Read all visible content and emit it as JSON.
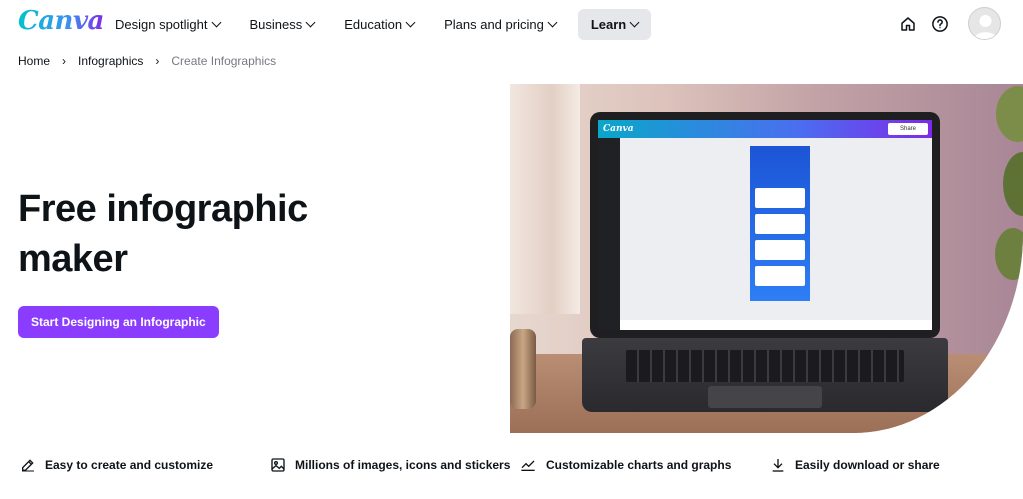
{
  "brand": {
    "logo_text": "Canva",
    "accent": "#8b3dff",
    "logo_gradient": [
      "#00c4cc",
      "#7d2ae8"
    ]
  },
  "nav": {
    "items": [
      {
        "label": "Design spotlight",
        "icon": "chevron-down-icon"
      },
      {
        "label": "Business",
        "icon": "chevron-down-icon"
      },
      {
        "label": "Education",
        "icon": "chevron-down-icon"
      },
      {
        "label": "Plans and pricing",
        "icon": "chevron-down-icon"
      },
      {
        "label": "Learn",
        "icon": "chevron-down-icon",
        "active": true
      }
    ],
    "right_icons": [
      "home-icon",
      "help-icon",
      "avatar"
    ]
  },
  "breadcrumb": {
    "home": "Home",
    "section": "Infographics",
    "current": "Create Infographics"
  },
  "hero": {
    "title_line1": "Free infographic",
    "title_line2": "maker",
    "cta_label": "Start Designing an Infographic"
  },
  "mockup": {
    "app_logo": "Canva",
    "share_label": "Share"
  },
  "features": [
    {
      "label": "Easy to create and customize",
      "icon": "edit-icon"
    },
    {
      "label": "Millions of images, icons and stickers",
      "icon": "image-icon"
    },
    {
      "label": "Customizable charts and graphs",
      "icon": "chart-icon"
    },
    {
      "label": "Easily download or share",
      "icon": "download-icon"
    }
  ]
}
